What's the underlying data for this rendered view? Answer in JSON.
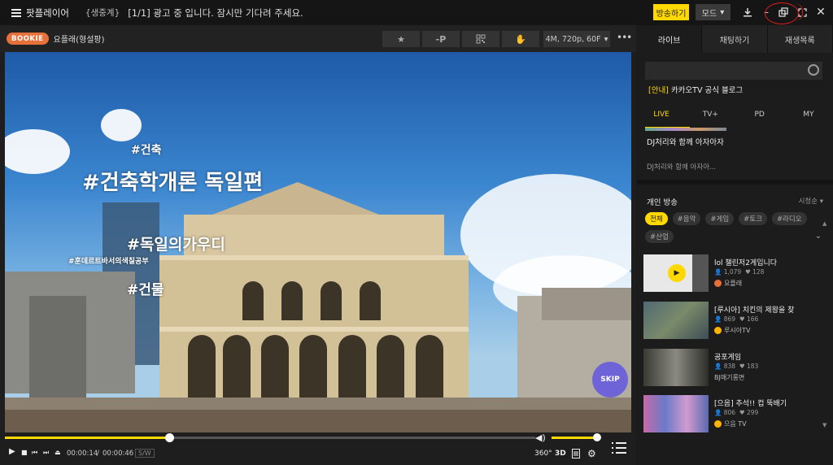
{
  "topbar": {
    "app_title": "팟플레이어",
    "live_tag": "{생중계}",
    "ad_message": "[1/1] 광고 중 입니다. 잠시만 기다려 주세요.",
    "broadcast_label": "방송하기",
    "mode_label": "모드"
  },
  "player": {
    "badge": "BOOKIE",
    "channel_name": "요플래(형설팡)",
    "quality_label": "4M, 720p, 60F",
    "skip_label": "SKIP",
    "time_current": "00:00:14",
    "time_total": "00:00:46",
    "sw_label": "S/W",
    "label_360": "360°",
    "label_3d": "3D",
    "progress": 0.31,
    "volume": 0.95,
    "overlay_texts": [
      "#건축학개론 독일편",
      "#독일의가우디",
      "#건축",
      "#건물",
      "#훈데르트바서의색칠공부"
    ]
  },
  "sidebar": {
    "tabs": [
      "라이브",
      "채팅하기",
      "재생목록"
    ],
    "notice_tag": "[안내]",
    "notice_text": "카카오TV 공식 블로그",
    "live_tabs": [
      "LIVE",
      "TV+",
      "PD",
      "MY"
    ],
    "featured_title": "DJ처리와 함께 아자아자",
    "featured_channel": "DJ처리와 함께 아자아...",
    "section_title": "개인 방송",
    "sort_label": "시청순",
    "chips": [
      "전체",
      "#음악",
      "#게임",
      "#토크",
      "#라디오",
      "#산업"
    ],
    "items": [
      {
        "title": "lol 챌린저2게입니다",
        "viewers": "1,079",
        "likes": "128",
        "channel": "요플래",
        "color": "#e8703a"
      },
      {
        "title": "[루시아] 치킨의 제왕을 찾",
        "viewers": "869",
        "likes": "166",
        "channel": "루시아TV",
        "color": "#ffb400"
      },
      {
        "title": "공포게임",
        "viewers": "838",
        "likes": "183",
        "channel": "BJ매기롱면",
        "color": ""
      },
      {
        "title": "[으음] 추석!! 컵 뚝배기",
        "viewers": "806",
        "likes": "299",
        "channel": "으음 TV",
        "color": "#ffb400"
      }
    ]
  }
}
